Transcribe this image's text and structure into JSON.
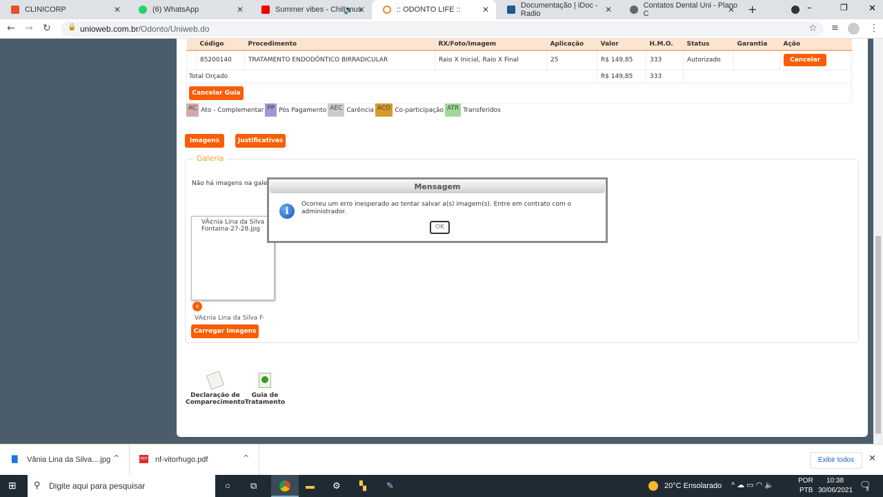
{
  "browser": {
    "tabs": [
      {
        "title": "CLINICORP"
      },
      {
        "title": "(6) WhatsApp"
      },
      {
        "title": "Summer vibes - Chill mus"
      },
      {
        "title": ":: ODONTO LIFE ::"
      },
      {
        "title": "Documentação | iDoc - Radio"
      },
      {
        "title": "Contatos Dental Uni - Plano C"
      }
    ],
    "url_host": "unioweb.com.br",
    "url_path": "/Odonto/Uniweb.do"
  },
  "table": {
    "headers": [
      "",
      "Código",
      "Procedimento",
      "RX/Foto/Imagem",
      "Aplicação",
      "Valor",
      "H.M.O.",
      "Status",
      "Garantia",
      "Ação"
    ],
    "row": {
      "codigo": "85200140",
      "procedimento": "TRATAMENTO ENDODÔNTICO BIRRADICULAR",
      "rx": "Raio X Inicial, Raio X Final",
      "aplicacao": "25",
      "valor": "R$ 149,85",
      "hmo": "333",
      "status": "Autorizado",
      "acao": "Cancelar"
    },
    "total": {
      "label": "Total Orçado",
      "valor": "R$ 149,85",
      "hmo": "333"
    }
  },
  "cancel_guide": "Cancelar Guia",
  "legend": [
    {
      "code": "AC",
      "label": "Ato - Complementar",
      "color": "#d4a9a9"
    },
    {
      "code": "PP",
      "label": "Pós Pagamento",
      "color": "#9a9ad4"
    },
    {
      "code": "AEC",
      "label": "Carência",
      "color": "#cccccc"
    },
    {
      "code": "ACO",
      "label": "Co-participação",
      "color": "#d89a2e"
    },
    {
      "code": "ATR",
      "label": "Transferidos",
      "color": "#9fd89a"
    }
  ],
  "buttons": {
    "imagens": "Imagens",
    "justificativas": "Justificativas",
    "carregar": "Carregar Imagens"
  },
  "gallery": {
    "title": "Galeria",
    "empty": "Não há imagens na galeria",
    "img_alt": "VÃ¢nia Lina da Silva Fontaina-27-28.jpg",
    "filename": "VÃ¢nia Lina da Silva Fo",
    "remove": "x"
  },
  "modal": {
    "title": "Mensagem",
    "text": "Ocorreu um erro inesperado ao tentar salvar a(s) imagem(s). Entre em contrato com o administrador.",
    "ok": "OK"
  },
  "docs": [
    {
      "label": "Declaração de Comparecimento"
    },
    {
      "label": "Guia de Tratamento"
    }
  ],
  "downloads": {
    "items": [
      {
        "name": "Vânia Lina da Silva....jpg"
      },
      {
        "name": "nf-vitorhugo.pdf"
      }
    ],
    "show_all": "Exibir todos"
  },
  "taskbar": {
    "search": "Digite aqui para pesquisar",
    "weather": "20°C  Ensolarado",
    "lang1": "POR",
    "lang2": "PTB",
    "time": "10:38",
    "date": "30/06/2021",
    "notifications": "3"
  }
}
